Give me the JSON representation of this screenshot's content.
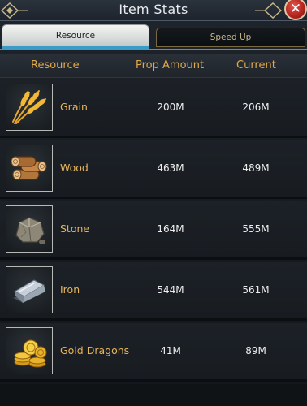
{
  "window": {
    "title": "Item Stats",
    "close_label": "✕"
  },
  "tabs": [
    {
      "label": "Resource",
      "active": true
    },
    {
      "label": "Speed Up",
      "active": false
    }
  ],
  "table": {
    "headers": [
      "Resource",
      "Prop Amount",
      "Current"
    ],
    "rows": [
      {
        "icon": "grain-icon",
        "name": "Grain",
        "prop_amount": "200M",
        "current": "206M"
      },
      {
        "icon": "wood-icon",
        "name": "Wood",
        "prop_amount": "463M",
        "current": "489M"
      },
      {
        "icon": "stone-icon",
        "name": "Stone",
        "prop_amount": "164M",
        "current": "555M"
      },
      {
        "icon": "iron-icon",
        "name": "Iron",
        "prop_amount": "544M",
        "current": "561M"
      },
      {
        "icon": "gold-dragons-icon",
        "name": "Gold Dragons",
        "prop_amount": "41M",
        "current": "89M"
      }
    ]
  },
  "colors": {
    "accent": "#3a9bc9",
    "header_text": "#e0a94a",
    "resource_name": "#e6b45a",
    "close_button": "#c0322a"
  }
}
